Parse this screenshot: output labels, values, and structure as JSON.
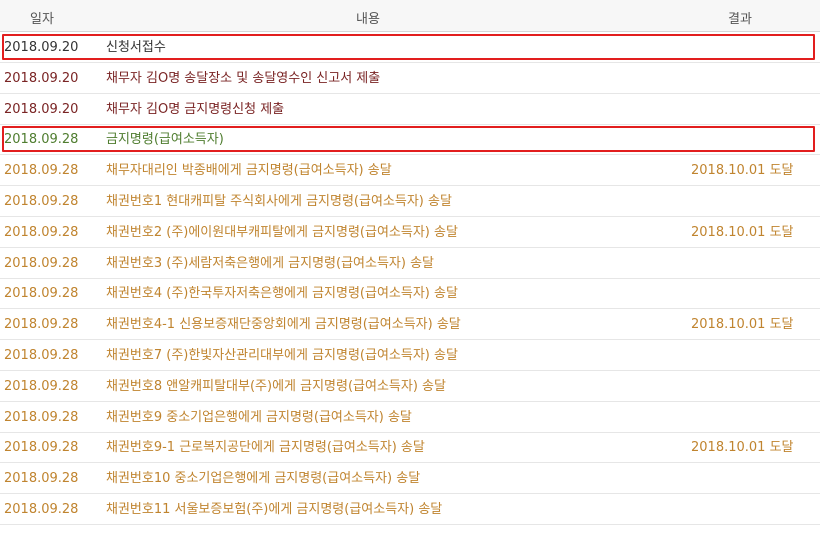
{
  "header": {
    "date": "일자",
    "content": "내용",
    "result": "결과"
  },
  "colors": {
    "dark": "#333333",
    "maroon": "#7a2424",
    "green": "#4f7d2f",
    "orange": "#c0842f",
    "highlight": "#e21e1e"
  },
  "rows": [
    {
      "date": "2018.09.20",
      "content": "신청서접수",
      "result": "",
      "color": "dark",
      "highlighted": true
    },
    {
      "date": "2018.09.20",
      "content": "채무자 김O명 송달장소 및 송달영수인 신고서 제출",
      "result": "",
      "color": "maroon",
      "highlighted": false
    },
    {
      "date": "2018.09.20",
      "content": "채무자 김O명 금지명령신청 제출",
      "result": "",
      "color": "maroon",
      "highlighted": false
    },
    {
      "date": "2018.09.28",
      "content": "금지명령(급여소득자)",
      "result": "",
      "color": "green",
      "highlighted": true
    },
    {
      "date": "2018.09.28",
      "content": "채무자대리인 박종배에게 금지명령(급여소득자) 송달",
      "result": "2018.10.01 도달",
      "color": "orange",
      "highlighted": false
    },
    {
      "date": "2018.09.28",
      "content": "채권번호1 현대캐피탈 주식회사에게 금지명령(급여소득자) 송달",
      "result": "",
      "color": "orange",
      "highlighted": false
    },
    {
      "date": "2018.09.28",
      "content": "채권번호2 (주)에이원대부캐피탈에게 금지명령(급여소득자) 송달",
      "result": "2018.10.01 도달",
      "color": "orange",
      "highlighted": false
    },
    {
      "date": "2018.09.28",
      "content": "채권번호3 (주)세람저축은행에게 금지명령(급여소득자) 송달",
      "result": "",
      "color": "orange",
      "highlighted": false
    },
    {
      "date": "2018.09.28",
      "content": "채권번호4 (주)한국투자저축은행에게 금지명령(급여소득자) 송달",
      "result": "",
      "color": "orange",
      "highlighted": false
    },
    {
      "date": "2018.09.28",
      "content": "채권번호4-1 신용보증재단중앙회에게 금지명령(급여소득자) 송달",
      "result": "2018.10.01 도달",
      "color": "orange",
      "highlighted": false
    },
    {
      "date": "2018.09.28",
      "content": "채권번호7 (주)한빛자산관리대부에게 금지명령(급여소득자) 송달",
      "result": "",
      "color": "orange",
      "highlighted": false
    },
    {
      "date": "2018.09.28",
      "content": "채권번호8 앤알캐피탈대부(주)에게 금지명령(급여소득자) 송달",
      "result": "",
      "color": "orange",
      "highlighted": false
    },
    {
      "date": "2018.09.28",
      "content": "채권번호9 중소기업은행에게 금지명령(급여소득자) 송달",
      "result": "",
      "color": "orange",
      "highlighted": false
    },
    {
      "date": "2018.09.28",
      "content": "채권번호9-1 근로복지공단에게 금지명령(급여소득자) 송달",
      "result": "2018.10.01 도달",
      "color": "orange",
      "highlighted": false
    },
    {
      "date": "2018.09.28",
      "content": "채권번호10 중소기업은행에게 금지명령(급여소득자) 송달",
      "result": "",
      "color": "orange",
      "highlighted": false
    },
    {
      "date": "2018.09.28",
      "content": "채권번호11 서울보증보험(주)에게 금지명령(급여소득자) 송달",
      "result": "",
      "color": "orange",
      "highlighted": false
    }
  ]
}
